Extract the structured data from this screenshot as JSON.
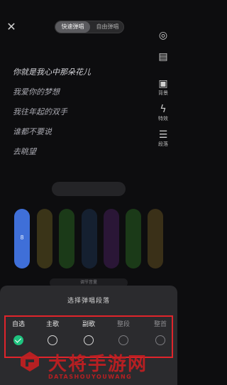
{
  "header": {
    "mode_tabs": [
      "快速弹唱",
      "自由弹唱"
    ],
    "active_tab": 0
  },
  "right_rail": [
    {
      "icon": "image-icon",
      "label": "背景"
    },
    {
      "icon": "bolt-icon",
      "label": "特效"
    },
    {
      "icon": "list-icon",
      "label": "段落"
    }
  ],
  "lyrics": [
    "你就是我心中那朵花儿",
    "我爱你的梦想",
    "我往年起的双手",
    "谁都不要说",
    "去眺望"
  ],
  "lyrics_accent_line": 0,
  "pad_label": "8",
  "hint_text": "调节音量",
  "sheet": {
    "title": "选择弹唱段落",
    "options": [
      {
        "label": "自选",
        "checked": true,
        "enabled": true
      },
      {
        "label": "主歌",
        "checked": false,
        "enabled": true
      },
      {
        "label": "副歌",
        "checked": false,
        "enabled": true
      },
      {
        "label": "整段",
        "checked": false,
        "enabled": false
      },
      {
        "label": "整首",
        "checked": false,
        "enabled": false
      }
    ]
  },
  "watermark": {
    "title": "大将手游网",
    "subtitle": "DATASHOUYOUWANG"
  },
  "colors": {
    "accent_green": "#1fc37f",
    "highlight_red": "#e0242b",
    "watermark_red": "#c21f22",
    "pad_blue": "#3f6fd8"
  }
}
